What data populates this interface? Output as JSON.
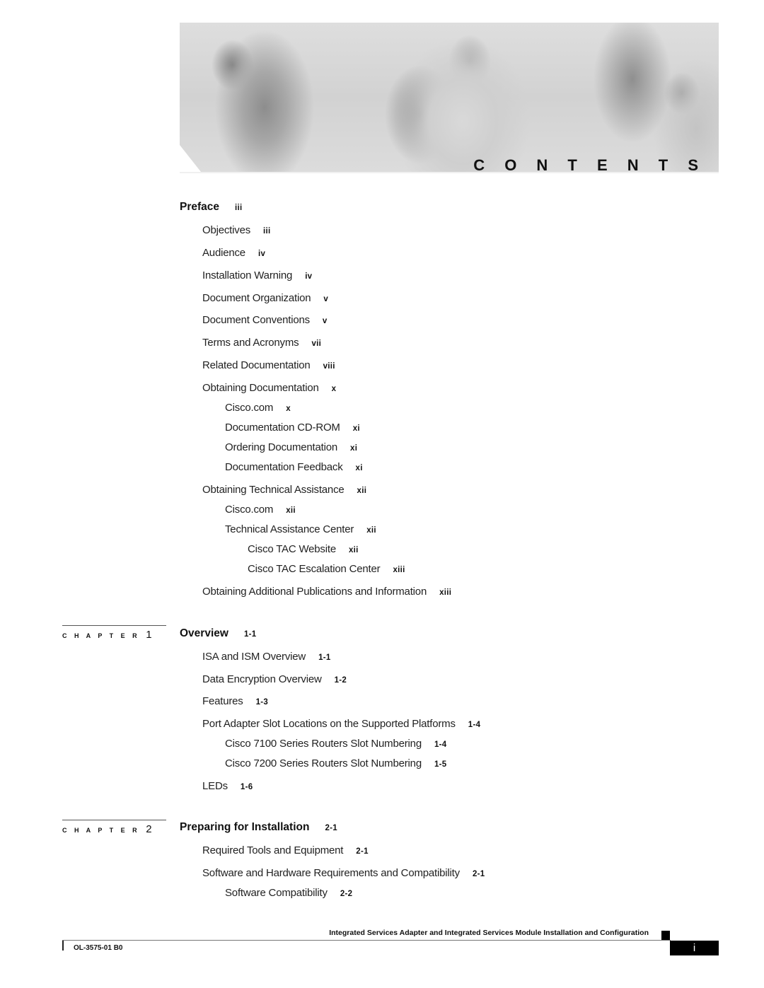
{
  "banner": {
    "title": "C O N T E N T S",
    "image": "photo-of-four-people-working-with-laptop-and-equipment"
  },
  "preface": {
    "title": "Preface",
    "page": "iii",
    "entries": [
      {
        "label": "Objectives",
        "page": "iii",
        "level": 1
      },
      {
        "label": "Audience",
        "page": "iv",
        "level": 1
      },
      {
        "label": "Installation Warning",
        "page": "iv",
        "level": 1
      },
      {
        "label": "Document Organization",
        "page": "v",
        "level": 1
      },
      {
        "label": "Document Conventions",
        "page": "v",
        "level": 1
      },
      {
        "label": "Terms and Acronyms",
        "page": "vii",
        "level": 1
      },
      {
        "label": "Related Documentation",
        "page": "viii",
        "level": 1
      },
      {
        "label": "Obtaining Documentation",
        "page": "x",
        "level": 1
      },
      {
        "label": "Cisco.com",
        "page": "x",
        "level": 2
      },
      {
        "label": "Documentation CD-ROM",
        "page": "xi",
        "level": 2
      },
      {
        "label": "Ordering Documentation",
        "page": "xi",
        "level": 2
      },
      {
        "label": "Documentation Feedback",
        "page": "xi",
        "level": 2
      },
      {
        "label": "Obtaining Technical Assistance",
        "page": "xii",
        "level": 1
      },
      {
        "label": "Cisco.com",
        "page": "xii",
        "level": 2
      },
      {
        "label": "Technical Assistance Center",
        "page": "xii",
        "level": 2
      },
      {
        "label": "Cisco TAC Website",
        "page": "xii",
        "level": 3
      },
      {
        "label": "Cisco TAC Escalation Center",
        "page": "xiii",
        "level": 3
      },
      {
        "label": "Obtaining Additional Publications and Information",
        "page": "xiii",
        "level": 1
      }
    ]
  },
  "chapters": [
    {
      "label": "C H A P T E R",
      "number": "1",
      "title": "Overview",
      "page": "1-1",
      "entries": [
        {
          "label": "ISA and ISM Overview",
          "page": "1-1",
          "level": 1
        },
        {
          "label": "Data Encryption Overview",
          "page": "1-2",
          "level": 1
        },
        {
          "label": "Features",
          "page": "1-3",
          "level": 1
        },
        {
          "label": "Port Adapter Slot Locations on the Supported Platforms",
          "page": "1-4",
          "level": 1
        },
        {
          "label": "Cisco 7100 Series Routers Slot Numbering",
          "page": "1-4",
          "level": 2
        },
        {
          "label": "Cisco 7200 Series Routers Slot Numbering",
          "page": "1-5",
          "level": 2
        },
        {
          "label": "LEDs",
          "page": "1-6",
          "level": 1
        }
      ]
    },
    {
      "label": "C H A P T E R",
      "number": "2",
      "title": "Preparing for Installation",
      "page": "2-1",
      "entries": [
        {
          "label": "Required Tools and Equipment",
          "page": "2-1",
          "level": 1
        },
        {
          "label": "Software and Hardware Requirements and Compatibility",
          "page": "2-1",
          "level": 1
        },
        {
          "label": "Software Compatibility",
          "page": "2-2",
          "level": 2
        }
      ]
    }
  ],
  "footer": {
    "book_title": "Integrated Services Adapter and Integrated Services Module Installation and Configuration",
    "doc_number": "OL-3575-01 B0",
    "page_number": "i"
  }
}
